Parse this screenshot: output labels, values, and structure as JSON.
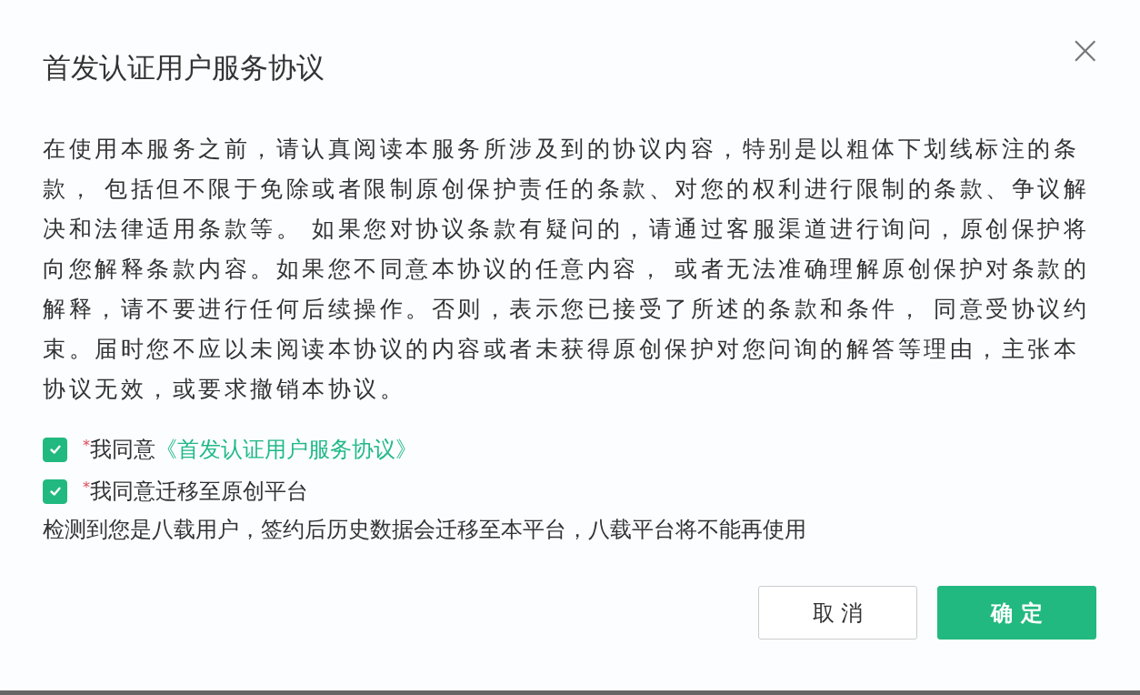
{
  "dialog": {
    "title": "首发认证用户服务协议",
    "close": "×",
    "body": "在使用本服务之前，请认真阅读本服务所涉及到的协议内容，特别是以粗体下划线标注的条款， 包括但不限于免除或者限制原创保护责任的条款、对您的权利进行限制的条款、争议解决和法律适用条款等。 如果您对协议条款有疑问的，请通过客服渠道进行询问，原创保护将向您解释条款内容。如果您不同意本协议的任意内容， 或者无法准确理解原创保护对条款的解释，请不要进行任何后续操作。否则，表示您已接受了所述的条款和条件， 同意受协议约束。届时您不应以未阅读本协议的内容或者未获得原创保护对您问询的解答等理由，主张本协议无效，或要求撤销本协议。",
    "agreements": [
      {
        "checked": true,
        "required_mark": "*",
        "label": "我同意",
        "link": "《首发认证用户服务协议》"
      },
      {
        "checked": true,
        "required_mark": "*",
        "label": "我同意迁移至原创平台"
      }
    ],
    "notice": "检测到您是八载用户，签约后历史数据会迁移至本平台，八载平台将不能再使用",
    "buttons": [
      {
        "kind": "secondary",
        "label": "取 消"
      },
      {
        "kind": "primary",
        "label": "确 定"
      }
    ]
  }
}
